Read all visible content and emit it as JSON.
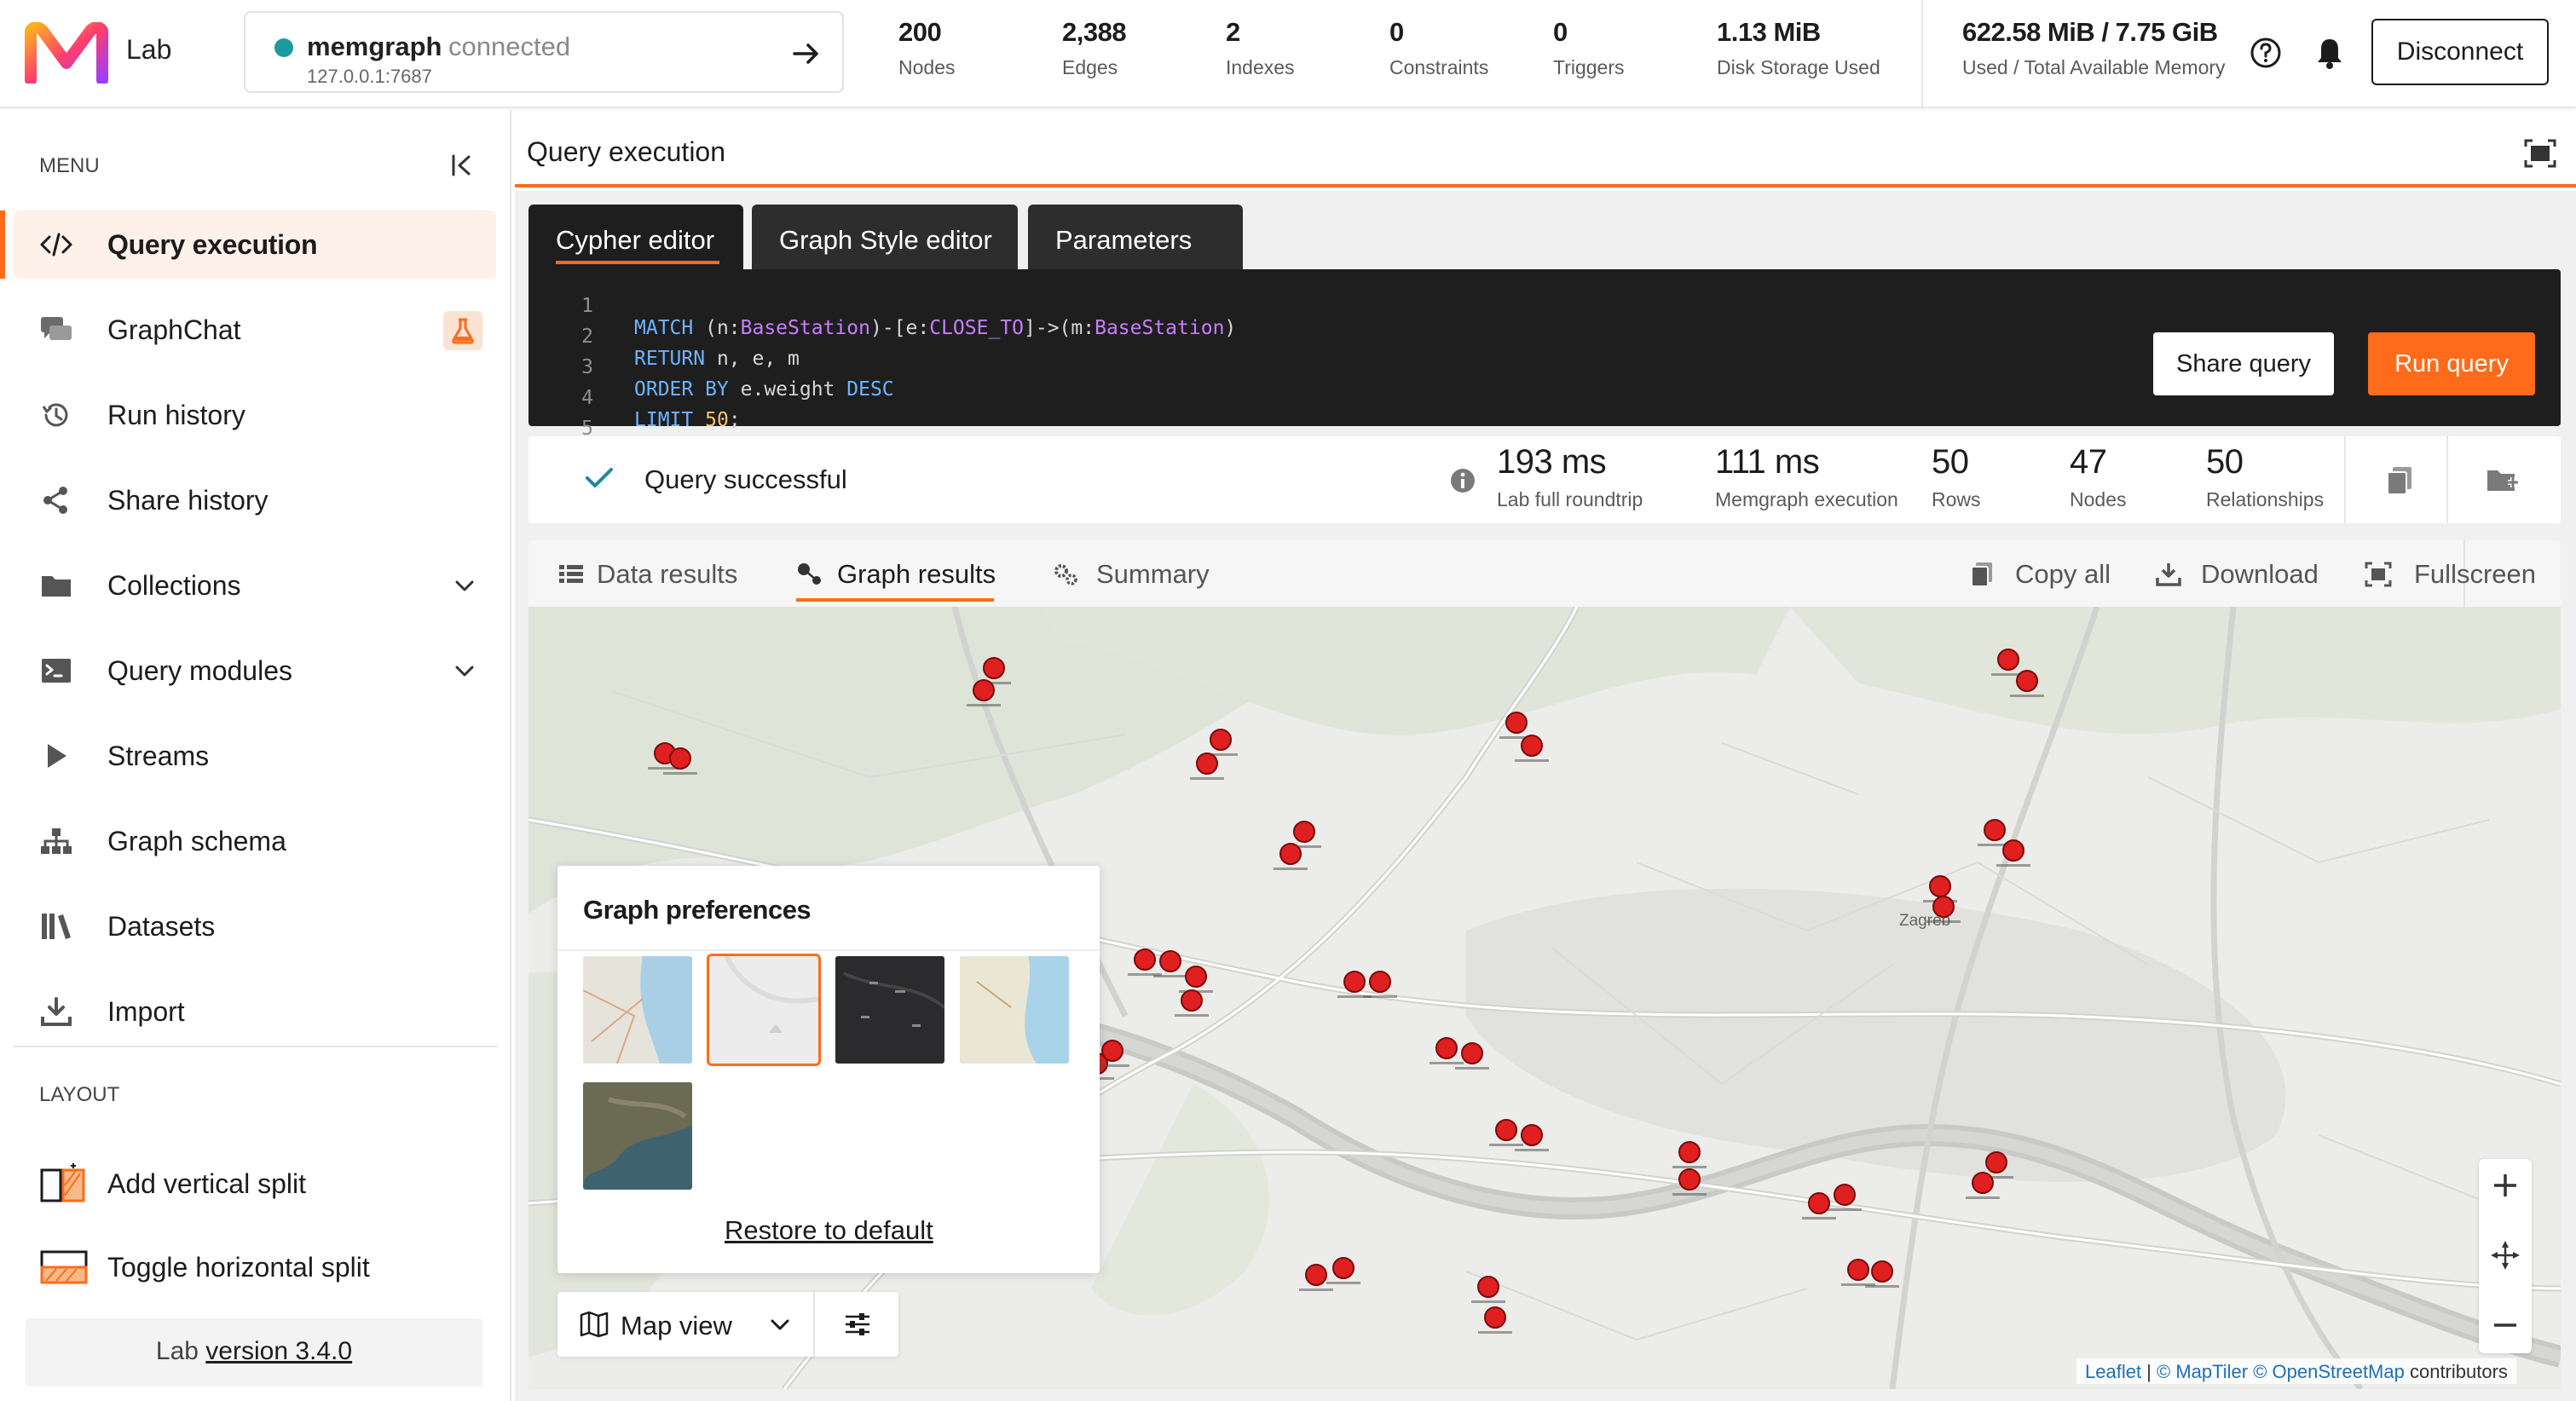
{
  "header": {
    "app_name": "Lab",
    "connection": {
      "name": "memgraph",
      "status": "connected",
      "host": "127.0.0.1:7687"
    },
    "stats": [
      {
        "value": "200",
        "label": "Nodes"
      },
      {
        "value": "2,388",
        "label": "Edges"
      },
      {
        "value": "2",
        "label": "Indexes"
      },
      {
        "value": "0",
        "label": "Constraints"
      },
      {
        "value": "0",
        "label": "Triggers"
      },
      {
        "value": "1.13 MiB",
        "label": "Disk Storage Used"
      },
      {
        "value": "622.58 MiB / 7.75 GiB",
        "label": "Used / Total Available Memory"
      }
    ],
    "disconnect_label": "Disconnect"
  },
  "sidebar": {
    "menu_heading": "MENU",
    "items": [
      {
        "label": "Query execution",
        "icon": "code-icon",
        "active": true
      },
      {
        "label": "GraphChat",
        "icon": "chat-icon"
      },
      {
        "label": "Run history",
        "icon": "history-icon"
      },
      {
        "label": "Share history",
        "icon": "share-icon"
      },
      {
        "label": "Collections",
        "icon": "folder-icon"
      },
      {
        "label": "Query modules",
        "icon": "terminal-icon"
      },
      {
        "label": "Streams",
        "icon": "play-icon"
      },
      {
        "label": "Graph schema",
        "icon": "schema-icon"
      },
      {
        "label": "Datasets",
        "icon": "books-icon"
      },
      {
        "label": "Import",
        "icon": "import-icon"
      }
    ],
    "layout_heading": "LAYOUT",
    "layout_items": [
      {
        "label": "Add vertical split",
        "icon": "vertical-split-icon"
      },
      {
        "label": "Toggle horizontal split",
        "icon": "horizontal-split-icon"
      }
    ],
    "version_prefix": "Lab ",
    "version_link": "version 3.4.0"
  },
  "panel": {
    "title": "Query execution",
    "editor_tabs": [
      "Cypher editor",
      "Graph Style editor",
      "Parameters"
    ],
    "code_lines": [
      {
        "n": "1",
        "text": "MATCH (n:BaseStation)-[e:CLOSE_TO]->(m:BaseStation)"
      },
      {
        "n": "2",
        "text": "RETURN n, e, m"
      },
      {
        "n": "3",
        "text": "ORDER BY e.weight DESC"
      },
      {
        "n": "4",
        "text": "LIMIT 50;"
      },
      {
        "n": "5",
        "text": ""
      }
    ],
    "share_query_label": "Share query",
    "run_query_label": "Run query"
  },
  "status": {
    "message": "Query successful",
    "metrics": [
      {
        "value": "193 ms",
        "label": "Lab full roundtrip"
      },
      {
        "value": "111 ms",
        "label": "Memgraph execution"
      },
      {
        "value": "50",
        "label": "Rows"
      },
      {
        "value": "47",
        "label": "Nodes"
      },
      {
        "value": "50",
        "label": "Relationships"
      }
    ]
  },
  "results": {
    "tabs": [
      "Data results",
      "Graph results",
      "Summary"
    ],
    "active_tab": "Graph results",
    "actions": [
      "Copy all",
      "Download",
      "Fullscreen"
    ]
  },
  "map": {
    "node_color": "#e02020",
    "city_labels": [
      "Zagreb"
    ],
    "preferences": {
      "title": "Graph preferences",
      "styles": [
        "osm",
        "light",
        "dark",
        "outdoor",
        "satellite"
      ],
      "selected_style": "light",
      "restore_label": "Restore to default"
    },
    "view_mode": "Map view",
    "attribution": {
      "leaflet": "Leaflet",
      "sep": " | ",
      "maptiler": "© MapTiler",
      "osm": "© OpenStreetMap",
      "suffix": " contributors"
    }
  }
}
